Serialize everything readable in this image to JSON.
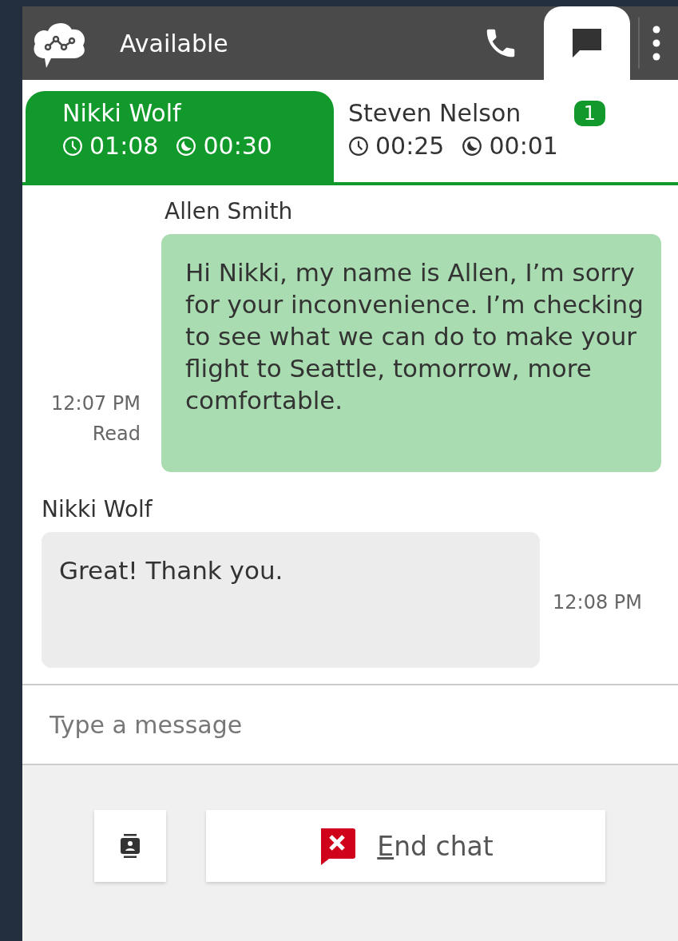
{
  "header": {
    "status": "Available",
    "nav": [
      {
        "kind": "phone",
        "selected": false
      },
      {
        "kind": "chat",
        "selected": true
      }
    ]
  },
  "contacts": [
    {
      "name": "Nikki Wolf",
      "selected": true,
      "total": "01:08",
      "wait": "00:30"
    },
    {
      "name": "Steven Nelson",
      "selected": false,
      "total": "00:25",
      "wait": "00:01",
      "badge": "1"
    }
  ],
  "messages": [
    {
      "kind": "agent",
      "sender": "Allen Smith",
      "text": "Hi Nikki, my name is Allen, I’m sorry for your inconvenience.  I’m checking to see what we can do to make your flight to Seattle, tomorrow, more comfortable.",
      "time": "12:07 PM",
      "status": "Read"
    },
    {
      "kind": "customer",
      "sender": "Nikki Wolf",
      "text": "Great! Thank you.",
      "time": "12:08 PM"
    }
  ],
  "composer": {
    "placeholder": "Type a message"
  },
  "end_button": "End chat"
}
